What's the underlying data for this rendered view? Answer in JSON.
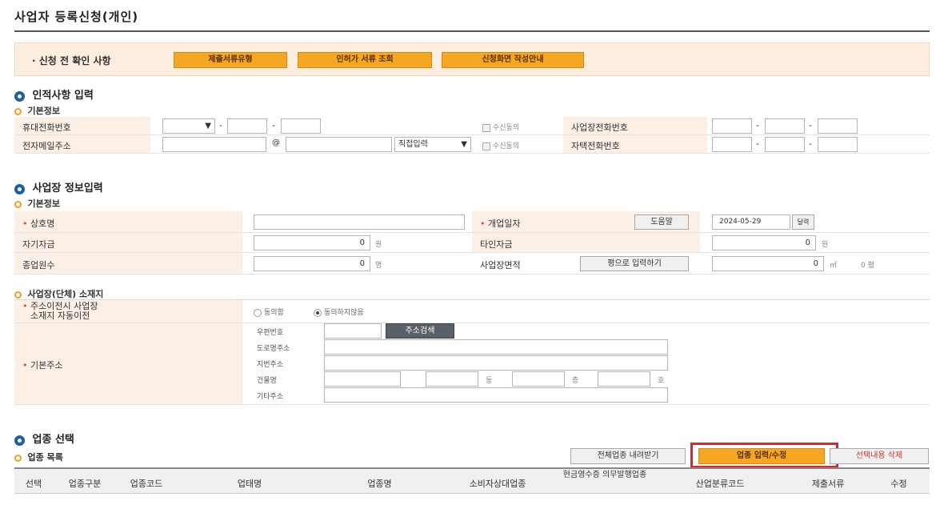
{
  "page_title": "사업자 등록신청(개인)",
  "notice": {
    "label": "· 신청 전 확인 사항",
    "buttons": [
      "제출서류유형",
      "인허가 서류 조회",
      "신청화면 작성안내"
    ]
  },
  "personal": {
    "section_title": "인적사항 입력",
    "sub_title": "기본정보",
    "mobile_label": "휴대전화번호",
    "email_label": "전자메일주소",
    "sep_dash": "-",
    "at_sign": "@",
    "email_domain_select": "직접입력",
    "consent_label": "수신동의",
    "biz_phone_label": "사업장전화번호",
    "home_phone_label": "자택전화번호"
  },
  "business": {
    "section_title": "사업장 정보입력",
    "sub_title": "기본정보",
    "trade_name_label": "상호명",
    "open_date_label": "개업일자",
    "help_button": "도움말",
    "open_date_value": "2024-05-29",
    "calendar_icon_label": "달력",
    "own_capital_label": "자기자금",
    "own_capital_value": "0",
    "others_capital_label": "타인자금",
    "others_capital_value": "0",
    "won_unit": "원",
    "employees_label": "종업원수",
    "employees_value": "0",
    "person_unit": "명",
    "area_label": "사업장면적",
    "pyeong_button": "평으로 입력하기",
    "area_value": "0",
    "area_unit": "㎡",
    "pyeong_value": "0 평"
  },
  "address": {
    "sub_title": "사업장(단체) 소재지",
    "auto_transfer_label_1": "주소이전시 사업장",
    "auto_transfer_label_2": "소재지 자동이전",
    "agree": "동의함",
    "disagree": "동의하지않음",
    "base_address_label": "기본주소",
    "postal_code_label": "우편번호",
    "search_button": "주소검색",
    "road_address_label": "도로명주소",
    "lot_address_label": "지번주소",
    "building_label": "건물명",
    "dong_unit": "동",
    "floor_unit": "층",
    "ho_unit": "호",
    "other_address_label": "기타주소"
  },
  "industry": {
    "section_title": "업종 선택",
    "sub_title": "업종 목록",
    "download_button": "전체업종 내려받기",
    "input_button": "업종 입력/수정",
    "delete_button": "선택내용 삭제",
    "columns": [
      "선택",
      "업종구분",
      "업종코드",
      "업태명",
      "업종명",
      "소비자상대업종",
      "현금영수증 의무발행업종",
      "산업분류코드",
      "제출서류",
      "수정"
    ],
    "highlight_color": "#d7282f"
  },
  "colors": {
    "accent_orange": "#f5a623",
    "label_bg": "#fbefe6",
    "section_blue": "#1a5fa8"
  }
}
